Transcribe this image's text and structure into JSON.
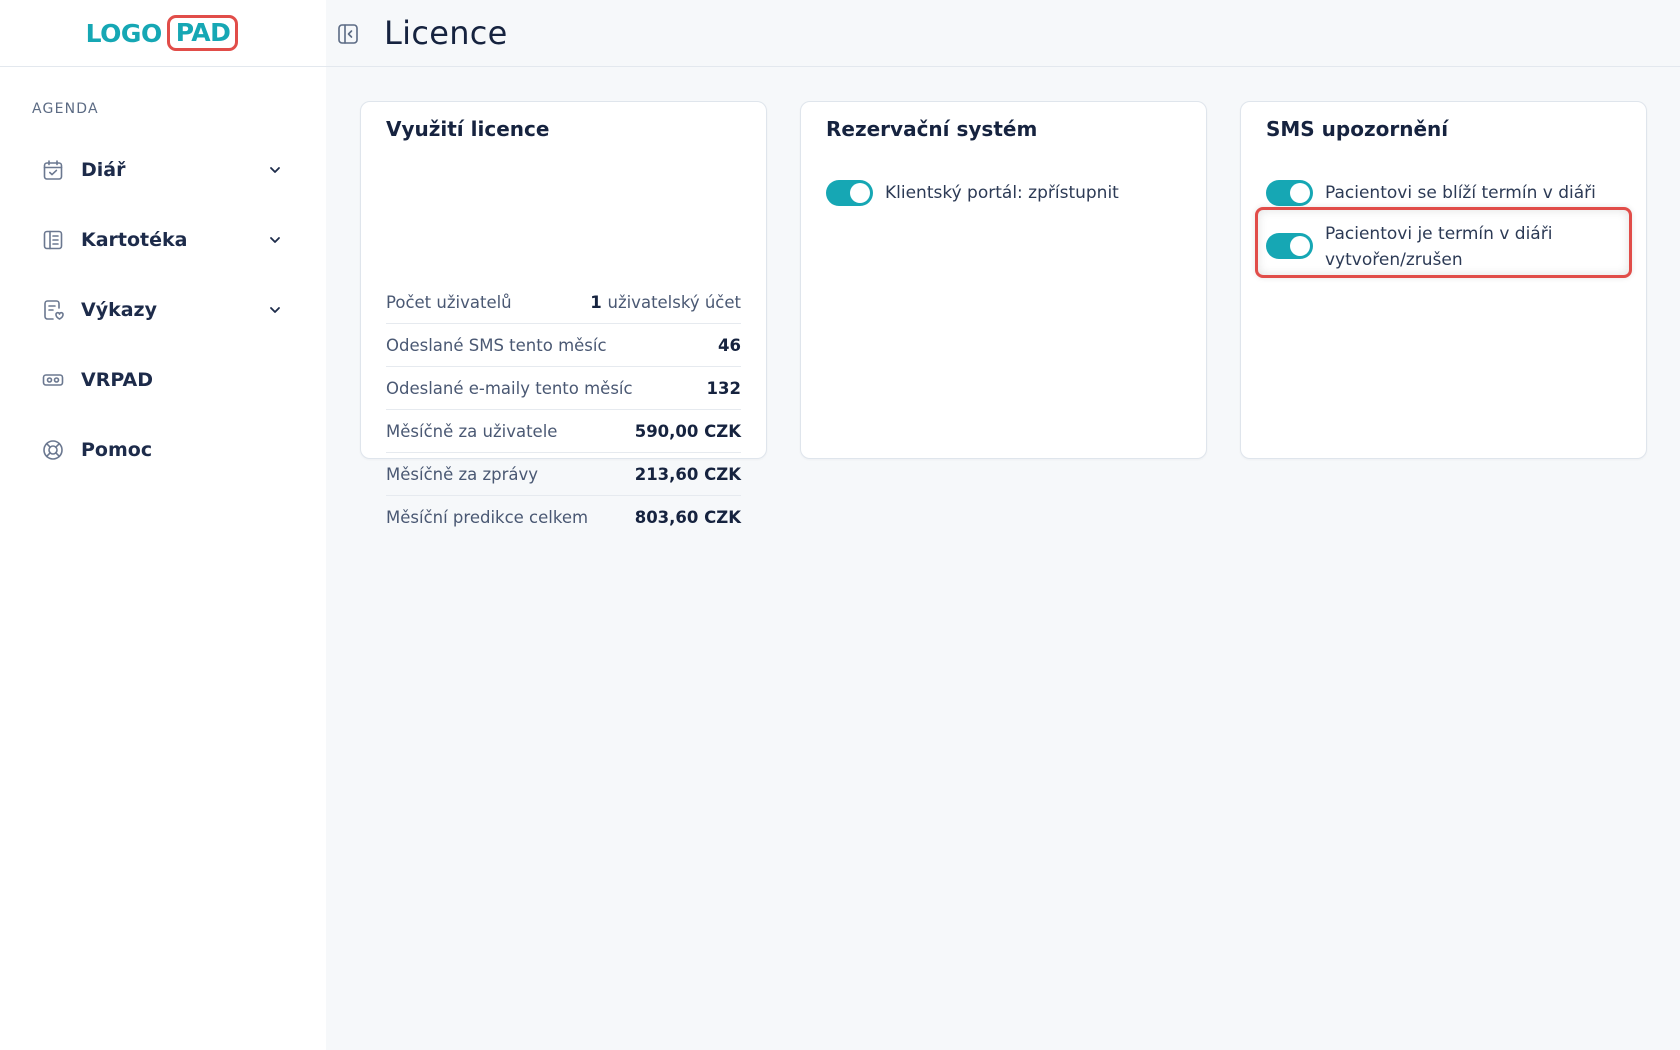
{
  "logo": {
    "part1": "LOGO",
    "part2": "PAD"
  },
  "sidebar": {
    "section_label": "AGENDA",
    "items": [
      {
        "label": "Diář",
        "icon": "calendar-check-icon",
        "has_chevron": true
      },
      {
        "label": "Kartotéka",
        "icon": "card-index-icon",
        "has_chevron": true
      },
      {
        "label": "Výkazy",
        "icon": "report-icon",
        "has_chevron": true
      },
      {
        "label": "VRPAD",
        "icon": "vr-headset-icon",
        "has_chevron": false
      },
      {
        "label": "Pomoc",
        "icon": "lifebuoy-icon",
        "has_chevron": false
      }
    ]
  },
  "header": {
    "title": "Licence"
  },
  "license_card": {
    "title": "Využití licence",
    "rows": [
      {
        "label": "Počet uživatelů",
        "value": "1",
        "unit": "uživatelský účet"
      },
      {
        "label": "Odeslané SMS tento měsíc",
        "value": "46"
      },
      {
        "label": "Odeslané e-maily tento měsíc",
        "value": "132"
      },
      {
        "label": "Měsíčně za uživatele",
        "value": "590,00 CZK"
      },
      {
        "label": "Měsíčně za zprávy",
        "value": "213,60 CZK"
      },
      {
        "label": "Měsíční predikce celkem",
        "value": "803,60 CZK"
      }
    ]
  },
  "reservation_card": {
    "title": "Rezervační systém",
    "toggles": [
      {
        "label": "Klientský portál: zpřístupnit",
        "on": true
      }
    ]
  },
  "sms_card": {
    "title": "SMS upozornění",
    "toggles": [
      {
        "label": "Pacientovi se blíží termín v diáři",
        "on": true
      },
      {
        "label_line1": "Pacientovi je termín v diáři",
        "label_line2": "vytvořen/zrušen",
        "on": true
      }
    ]
  },
  "colors": {
    "accent": "#16a7b4",
    "highlight": "#e14d49",
    "background": "#f6f8fa",
    "text": "#16233f"
  }
}
